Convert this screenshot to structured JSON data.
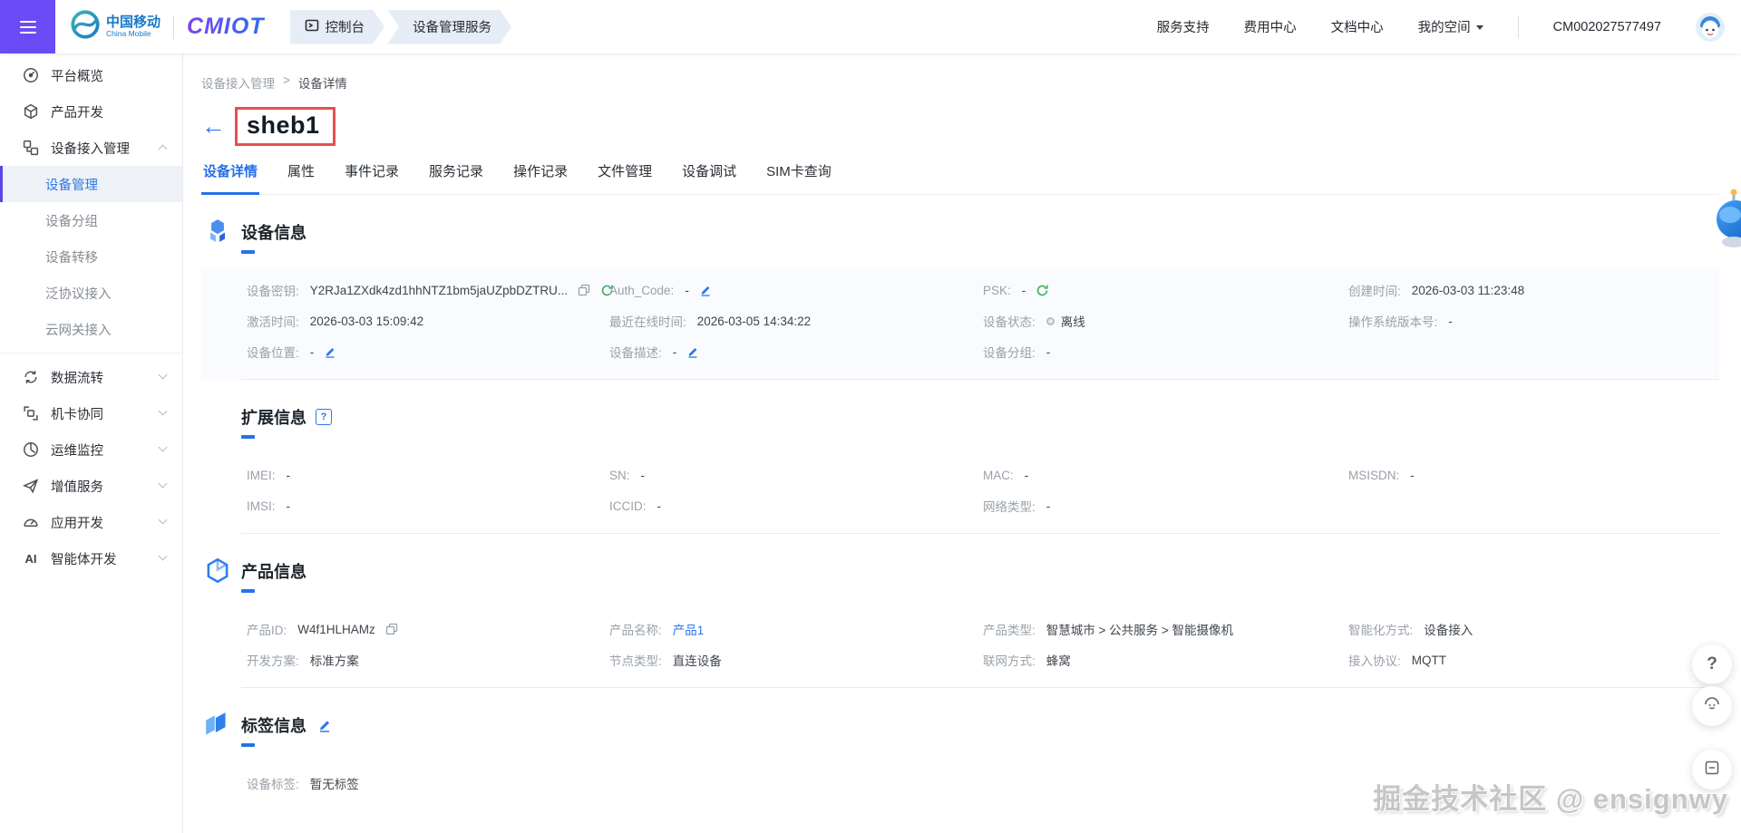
{
  "topbar": {
    "brand": {
      "cm_name": "中国移动",
      "cm_sub": "China Mobile",
      "cmiot": "CMIOT"
    },
    "console_tab": "控制台",
    "service_tab": "设备管理服务",
    "links": [
      "服务支持",
      "费用中心",
      "文档中心"
    ],
    "my_space": "我的空间",
    "account_id": "CM002027577497"
  },
  "sidebar": {
    "overview": "平台概览",
    "product_dev": "产品开发",
    "device_access_mgmt": "设备接入管理",
    "sub": [
      "设备管理",
      "设备分组",
      "设备转移",
      "泛协议接入",
      "云网关接入"
    ],
    "data_flow": "数据流转",
    "sim_collab": "机卡协同",
    "ops_monitor": "运维监控",
    "vas": "增值服务",
    "app_dev": "应用开发",
    "ai_icon_text": "AI",
    "ai_label": "智能体开发"
  },
  "breadcrumb": {
    "parent": "设备接入管理",
    "separator": ">",
    "current": "设备详情"
  },
  "page": {
    "back_arrow": "←",
    "title": "sheb1"
  },
  "tabs": [
    "设备详情",
    "属性",
    "事件记录",
    "服务记录",
    "操作记录",
    "文件管理",
    "设备调试",
    "SIM卡查询"
  ],
  "sections": {
    "device_info": {
      "title": "设备信息",
      "fields": [
        {
          "label": "设备密钥:",
          "value": "Y2RJa1ZXdk4zd1hhNTZ1bm5jaUZpbDZTRU..."
        },
        {
          "label": "Auth_Code:",
          "value": "-"
        },
        {
          "label": "PSK:",
          "value": "-"
        },
        {
          "label": "创建时间:",
          "value": "2026-03-03 11:23:48"
        },
        {
          "label": "激活时间:",
          "value": "2026-03-03 15:09:42"
        },
        {
          "label": "最近在线时间:",
          "value": "2026-03-05 14:34:22"
        },
        {
          "label": "设备状态:",
          "value": "离线"
        },
        {
          "label": "操作系统版本号:",
          "value": "-"
        },
        {
          "label": "设备位置:",
          "value": "-"
        },
        {
          "label": "设备描述:",
          "value": "-"
        },
        {
          "label": "设备分组:",
          "value": "-"
        }
      ]
    },
    "ext_info": {
      "title": "扩展信息",
      "help_glyph": "?",
      "fields": [
        {
          "label": "IMEI:",
          "value": "-"
        },
        {
          "label": "SN:",
          "value": "-"
        },
        {
          "label": "MAC:",
          "value": "-"
        },
        {
          "label": "MSISDN:",
          "value": "-"
        },
        {
          "label": "IMSI:",
          "value": "-"
        },
        {
          "label": "ICCID:",
          "value": "-"
        },
        {
          "label": "网络类型:",
          "value": "-"
        }
      ]
    },
    "product_info": {
      "title": "产品信息",
      "fields": [
        {
          "label": "产品ID:",
          "value": "W4f1HLHAMz"
        },
        {
          "label": "产品名称:",
          "value": "产品1"
        },
        {
          "label": "产品类型:",
          "value": "智慧城市 > 公共服务 > 智能摄像机"
        },
        {
          "label": "智能化方式:",
          "value": "设备接入"
        },
        {
          "label": "开发方案:",
          "value": "标准方案"
        },
        {
          "label": "节点类型:",
          "value": "直连设备"
        },
        {
          "label": "联网方式:",
          "value": "蜂窝"
        },
        {
          "label": "接入协议:",
          "value": "MQTT"
        }
      ]
    },
    "tag_info": {
      "title": "标签信息",
      "field": {
        "label": "设备标签:",
        "value": "暂无标签"
      }
    }
  },
  "watermark": "掘金技术社区 @ ensignwy",
  "colors": {
    "accent_blue": "#2571e8",
    "brand_purple": "#6b4bf5",
    "annotation_red": "#e5504f",
    "refresh_green": "#3fae63",
    "offline_gray": "#b9bec6"
  }
}
